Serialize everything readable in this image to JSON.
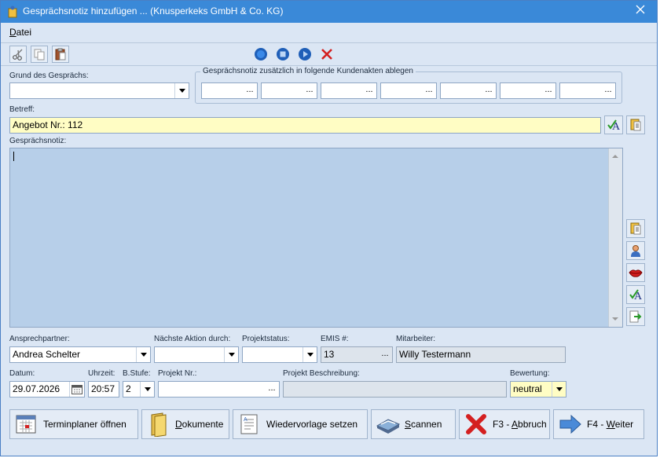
{
  "window": {
    "title": "Gesprächsnotiz hinzufügen ...  (Knusperkeks GmbH & Co. KG)"
  },
  "menu": {
    "datei_first": "D",
    "datei_rest": "atei"
  },
  "form": {
    "grund_label": "Grund des Gesprächs:",
    "grund_value": "",
    "akten_label": "Gesprächsnotiz zusätzlich in folgende Kundenakten ablegen",
    "dots": "...",
    "betreff_label": "Betreff:",
    "betreff_value": "Angebot Nr.: 112",
    "notiz_label": "Gesprächsnotiz:",
    "ansprechpartner_label": "Ansprechpartner:",
    "ansprechpartner_value": "Andrea Schelter",
    "naechste_label": "Nächste Aktion durch:",
    "naechste_value": "",
    "projektstatus_label": "Projektstatus:",
    "projektstatus_value": "",
    "emis_label": "EMIS #:",
    "emis_value": "13",
    "mitarbeiter_label": "Mitarbeiter:",
    "mitarbeiter_value": "Willy Testermann",
    "datum_label": "Datum:",
    "datum_value": "29.07.2026",
    "uhrzeit_label": "Uhrzeit:",
    "uhrzeit_value": "20:57",
    "bstufe_label": "B.Stufe:",
    "bstufe_value": "2",
    "projektnr_label": "Projekt Nr.:",
    "projektnr_value": "",
    "projektbeschr_label": "Projekt Beschreibung:",
    "projektbeschr_value": "",
    "bewertung_label": "Bewertung:",
    "bewertung_value": "neutral"
  },
  "buttons": {
    "terminplaner": "Terminplaner öffnen",
    "dokumente_u": "D",
    "dokumente_rest": "okumente",
    "wiedervorlage": "Wiedervorlage setzen",
    "scannen_u": "S",
    "scannen_rest": "cannen",
    "abbruch_pre": "F3 - ",
    "abbruch_u": "A",
    "abbruch_rest": "bbruch",
    "weiter_pre": "F4 - ",
    "weiter_u": "W",
    "weiter_rest": "eiter"
  },
  "colors": {
    "titlebar": "#3a89d8",
    "window_bg": "#dbe6f4",
    "memo_bg": "#b7cfe9",
    "highlight_field": "#fffdc4"
  }
}
